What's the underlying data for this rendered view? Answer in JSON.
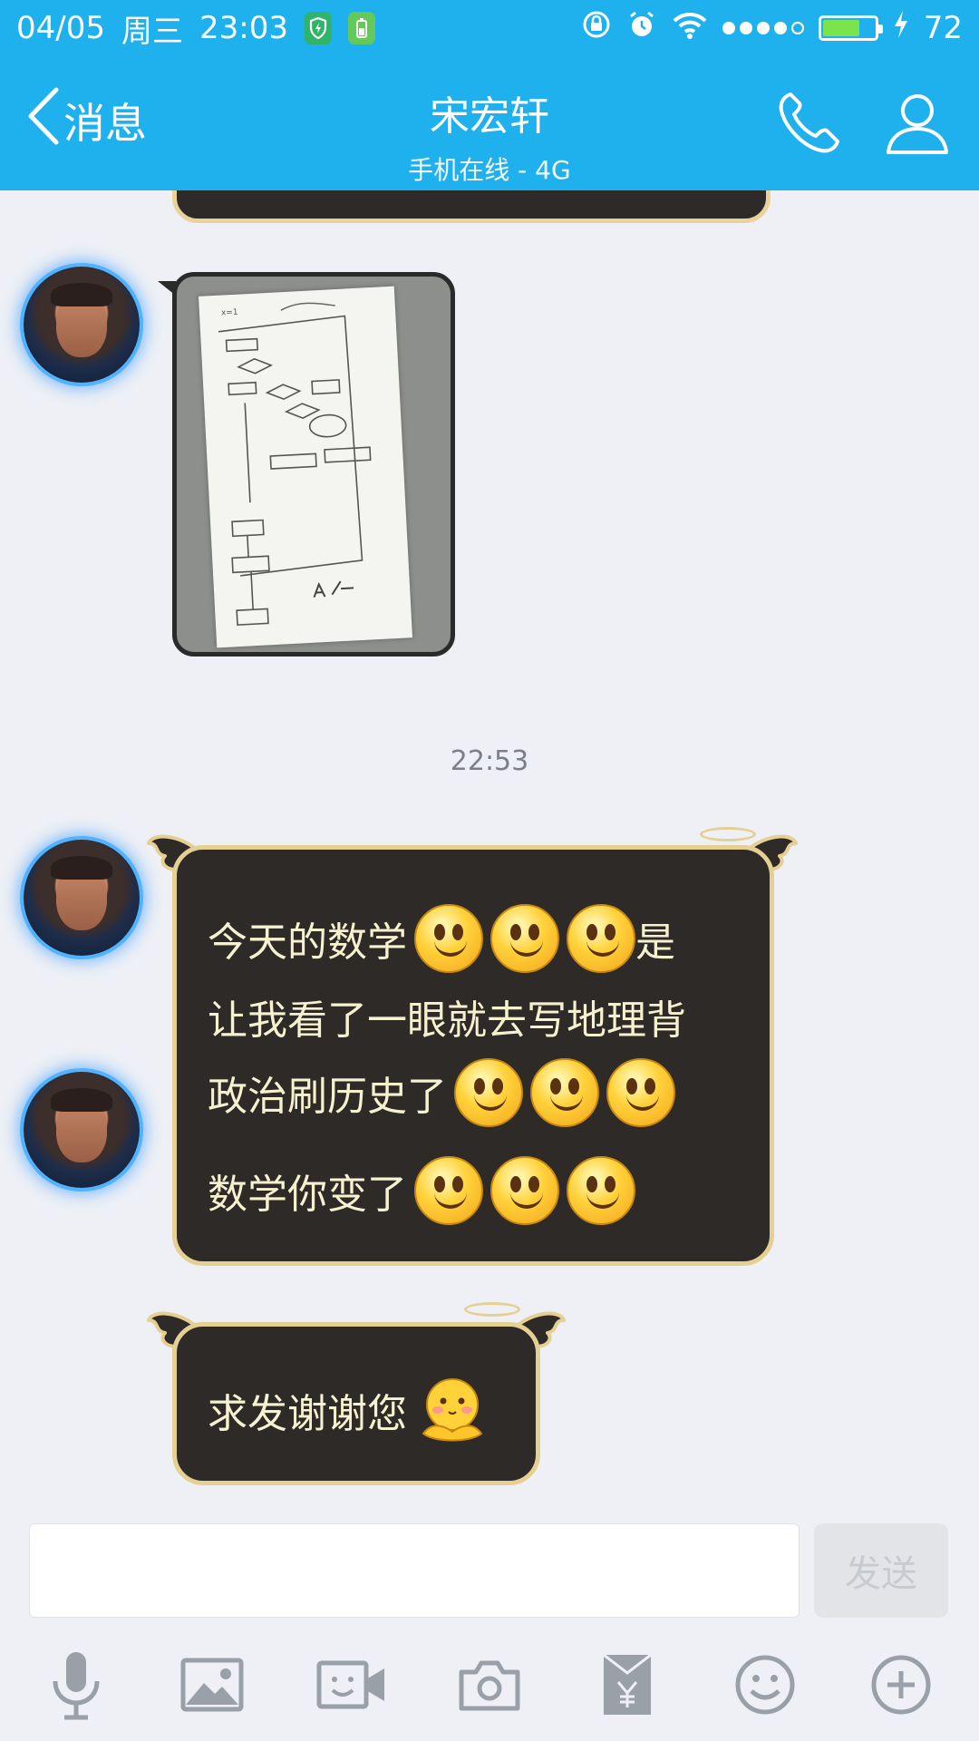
{
  "status_bar": {
    "date": "04/05",
    "weekday": "周三",
    "time": "23:03",
    "battery_percent": "72",
    "battery_level": 0.72,
    "signal_bars_filled": 4,
    "signal_bars_total": 5
  },
  "header": {
    "back_label": "消息",
    "contact_name": "宋宏轩",
    "contact_status": "手机在线 - 4G"
  },
  "messages": {
    "timestamp": "22:53",
    "msg1_lines": [
      "今天的数学",
      "是",
      "让我看了一眼就去写地理背",
      "政治刷历史了",
      "数学你变了"
    ],
    "msg2_text": "求发谢谢您"
  },
  "input": {
    "placeholder": "",
    "send_label": "发送"
  },
  "colors": {
    "accent": "#1fb0ee",
    "bubble_bg": "#2d2a28",
    "bubble_border": "#e6cf93",
    "bubble_text": "#f6f1cf"
  },
  "toolbar_icons": [
    "microphone-icon",
    "image-icon",
    "video-call-icon",
    "camera-icon",
    "red-packet-icon",
    "emoji-icon",
    "plus-icon"
  ]
}
